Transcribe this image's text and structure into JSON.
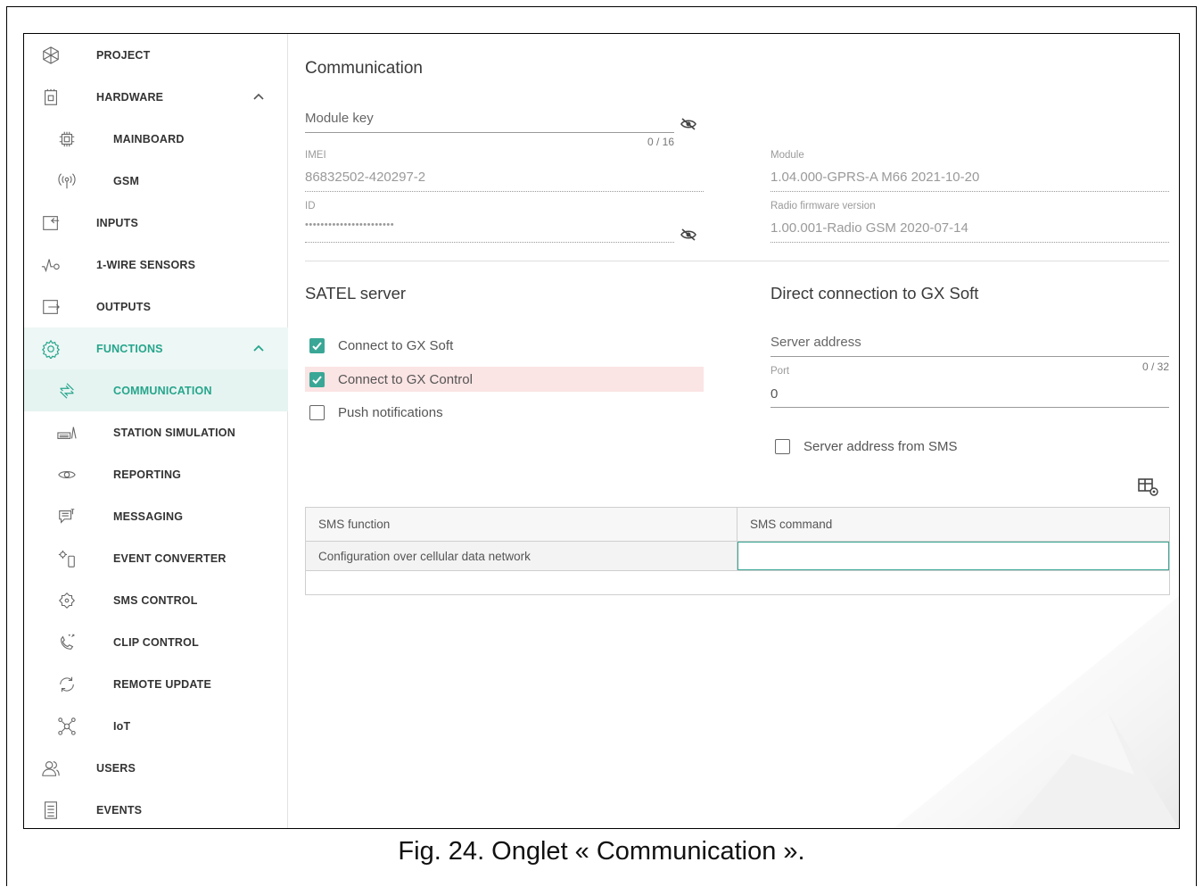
{
  "sidebar": {
    "items": [
      {
        "label": "PROJECT",
        "icon": "project-icon"
      },
      {
        "label": "HARDWARE",
        "icon": "hardware-icon"
      },
      {
        "label": "MAINBOARD",
        "icon": "mainboard-icon"
      },
      {
        "label": "GSM",
        "icon": "gsm-icon"
      },
      {
        "label": "INPUTS",
        "icon": "inputs-icon"
      },
      {
        "label": "1-WIRE SENSORS",
        "icon": "one-wire-sensors-icon"
      },
      {
        "label": "OUTPUTS",
        "icon": "outputs-icon"
      },
      {
        "label": "FUNCTIONS",
        "icon": "functions-icon"
      },
      {
        "label": "COMMUNICATION",
        "icon": "communication-icon"
      },
      {
        "label": "STATION SIMULATION",
        "icon": "station-simulation-icon"
      },
      {
        "label": "REPORTING",
        "icon": "reporting-icon"
      },
      {
        "label": "MESSAGING",
        "icon": "messaging-icon"
      },
      {
        "label": "EVENT CONVERTER",
        "icon": "event-converter-icon"
      },
      {
        "label": "SMS CONTROL",
        "icon": "sms-control-icon"
      },
      {
        "label": "CLIP CONTROL",
        "icon": "clip-control-icon"
      },
      {
        "label": "REMOTE UPDATE",
        "icon": "remote-update-icon"
      },
      {
        "label": "IoT",
        "icon": "iot-icon"
      },
      {
        "label": "USERS",
        "icon": "users-icon"
      },
      {
        "label": "EVENTS",
        "icon": "events-icon"
      }
    ],
    "accent_color": "#26a58c"
  },
  "main": {
    "title": "Communication",
    "module_key": {
      "label": "Module key",
      "value": "",
      "counter": "0 / 16"
    },
    "imei": {
      "label": "IMEI",
      "value": "86832502-420297-2"
    },
    "id": {
      "label": "ID",
      "value": "•••••••••••••••••••••••"
    },
    "module": {
      "label": "Module",
      "value": "1.04.000-GPRS-A M66 2021-10-20"
    },
    "radio_fw": {
      "label": "Radio firmware version",
      "value": "1.00.001-Radio GSM 2020-07-14"
    },
    "satel_server": {
      "title": "SATEL server",
      "options": [
        {
          "label": "Connect to GX Soft",
          "checked": true
        },
        {
          "label": "Connect to GX Control",
          "checked": true
        },
        {
          "label": "Push notifications",
          "checked": false
        }
      ]
    },
    "direct": {
      "title": "Direct connection to GX Soft",
      "server_address": {
        "label": "Server address",
        "value": "",
        "counter": "0 / 32"
      },
      "port": {
        "label": "Port",
        "value": "0"
      },
      "from_sms": {
        "label": "Server address from SMS",
        "checked": false
      }
    },
    "sms_table": {
      "columns": [
        "SMS function",
        "SMS command"
      ],
      "rows": [
        [
          "Configuration over cellular data network",
          ""
        ]
      ]
    }
  },
  "caption": "Fig. 24. Onglet « Communication »."
}
